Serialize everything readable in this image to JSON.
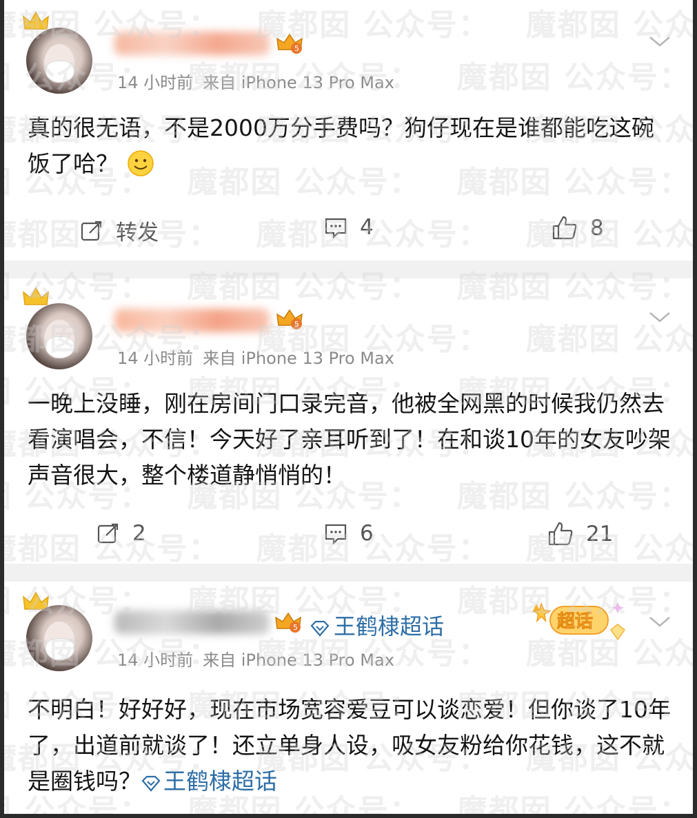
{
  "posts": [
    {
      "time": "14 小时前",
      "source": "来自 iPhone 13 Pro Max",
      "content": "真的很无语，不是2000万分手费吗？狗仔现在是谁都能吃这碗饭了哈？",
      "actions": {
        "repost": "转发",
        "comments": "4",
        "likes": "8"
      }
    },
    {
      "time": "14 小时前",
      "source": "来自 iPhone 13 Pro Max",
      "content": "一晚上没睡，刚在房间门口录完音，他被全网黑的时候我仍然去看演唱会，不信！今天好了亲耳听到了！在和谈10年的女友吵架声音很大，整个楼道静悄悄的！",
      "actions": {
        "repost": "2",
        "comments": "6",
        "likes": "21"
      }
    },
    {
      "time": "14 小时前",
      "source": "来自 iPhone 13 Pro Max",
      "topic": "王鹤棣超话",
      "badge": "超话",
      "content_text": "不明白！好好好，现在市场宽容爱豆可以谈恋爱！但你谈了10年了，出道前就谈了！还立单身人设，吸女友粉给你花钱，这不就是圈钱吗？",
      "content_topic": "王鹤棣超话"
    }
  ],
  "watermark": {
    "text": "魔都囡 公众号："
  },
  "colors": {
    "link": "#2e6ea6",
    "meta": "#8a8a8a",
    "separator": "#f1f1f1"
  }
}
